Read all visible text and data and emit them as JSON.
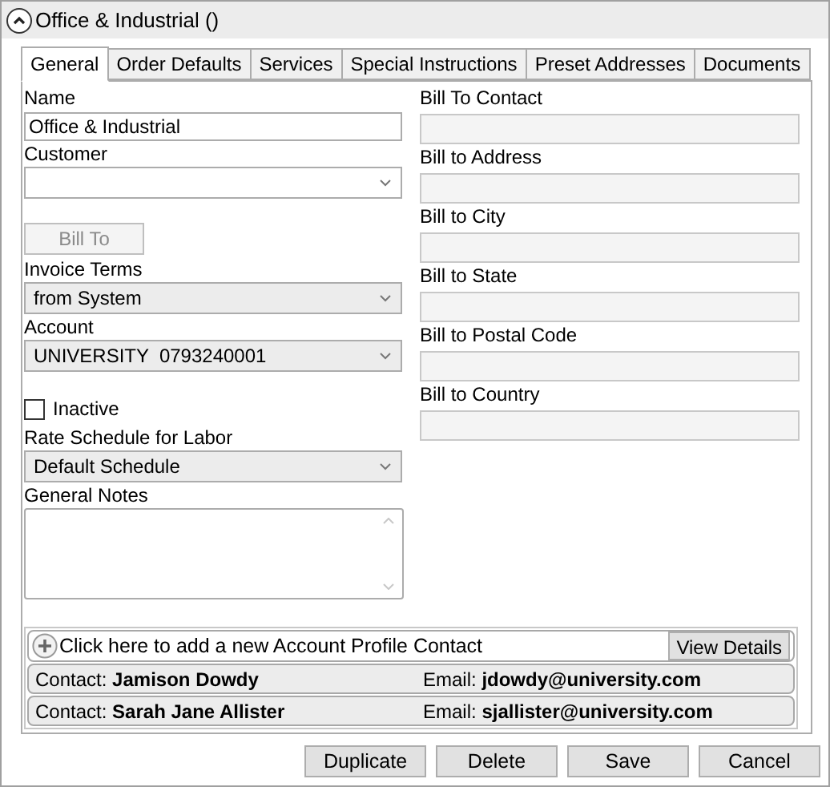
{
  "header": {
    "title": "Office & Industrial ()",
    "expanded": true
  },
  "tabs": [
    {
      "label": "General",
      "selected": true
    },
    {
      "label": "Order Defaults",
      "selected": false
    },
    {
      "label": "Services",
      "selected": false
    },
    {
      "label": "Special Instructions",
      "selected": false
    },
    {
      "label": "Preset Addresses",
      "selected": false
    },
    {
      "label": "Documents",
      "selected": false
    }
  ],
  "left_fields": [
    {
      "kind": "text",
      "label": "Name",
      "value": "Office & Industrial"
    },
    {
      "kind": "select",
      "label": "Customer"
    },
    {
      "kind": "button",
      "label": "Bill To",
      "disabled": true
    },
    {
      "kind": "select",
      "label": "Invoice Terms",
      "value": "from System"
    },
    {
      "kind": "select",
      "label": "Account",
      "value": "UNIVERSITY  0793240001"
    },
    {
      "kind": "checkbox",
      "label": "Inactive",
      "checked": false
    },
    {
      "kind": "select",
      "label": "Rate Schedule for Labor",
      "value": "Default Schedule"
    },
    {
      "kind": "textarea",
      "label": "General Notes"
    }
  ],
  "right_fields": [
    {
      "label": "Bill To Contact",
      "disabled": true
    },
    {
      "label": "Bill to Address",
      "disabled": true
    },
    {
      "label": "Bill to City",
      "disabled": true
    },
    {
      "label": "Bill to State",
      "disabled": true
    },
    {
      "label": "Bill to Postal Code",
      "disabled": true
    },
    {
      "label": "Bill to Country",
      "disabled": true
    }
  ],
  "add_contact": {
    "text": "Click here to add a new Account Profile Contact",
    "button": "View Details"
  },
  "contacts": [
    {
      "contact_label": "Contact:",
      "name": "Jamison Dowdy",
      "email_label": "Email:",
      "email": "jdowdy@university.com"
    },
    {
      "contact_label": "Contact:",
      "name": "Sarah Jane Allister",
      "email_label": "Email:",
      "email": "sjallister@university.com"
    }
  ],
  "buttons": [
    "Duplicate",
    "Delete",
    "Save",
    "Cancel"
  ]
}
